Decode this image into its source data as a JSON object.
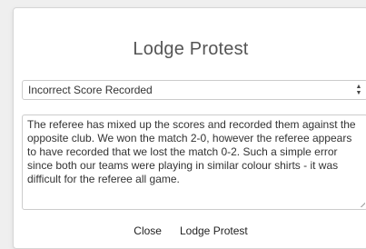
{
  "dialog": {
    "title": "Lodge Protest",
    "reason_select": {
      "selected": "Incorrect Score Recorded"
    },
    "details_text": "The referee has mixed up the scores and recorded them against the opposite club. We won the match 2-0, however the referee appears to have recorded that we lost the match 0-2. Such a simple error since both our teams were playing in similar colour shirts - it was difficult for the referee all game.",
    "buttons": {
      "close_label": "Close",
      "lodge_label": "Lodge Protest"
    }
  },
  "icons": {
    "select_arrows": "select-arrows-icon",
    "resize": "resize-grip-icon"
  }
}
